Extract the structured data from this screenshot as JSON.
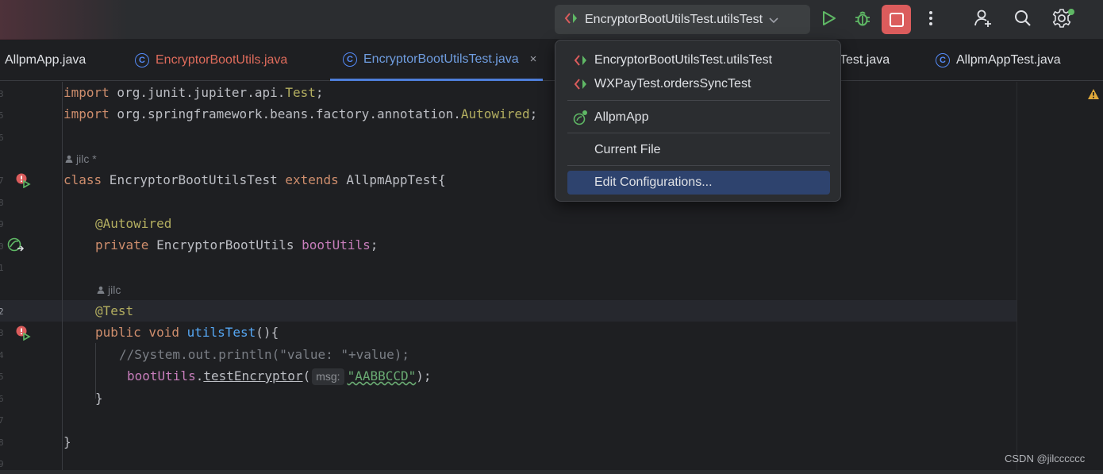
{
  "toolbar": {
    "run_config_label": "EncryptorBootUtilsTest.utilsTest"
  },
  "tabs": [
    {
      "label": "AllpmApp.java"
    },
    {
      "label": "EncryptorBootUtils.java"
    },
    {
      "label": "EncryptorBootUtilsTest.java"
    },
    {
      "label": "Test.java"
    },
    {
      "label": "AllpmAppTest.java"
    }
  ],
  "tab_close_glyph": "×",
  "menu": {
    "items": [
      {
        "label": "EncryptorBootUtilsTest.utilsTest"
      },
      {
        "label": "WXPayTest.ordersSyncTest"
      },
      {
        "label": "AllpmApp"
      },
      {
        "label": "Current File"
      },
      {
        "label": "Edit Configurations..."
      }
    ]
  },
  "editor": {
    "line_numbers": [
      "3",
      "5",
      "6",
      "7",
      "8",
      "9",
      "0",
      "1",
      "2",
      "3",
      "4",
      "5",
      "6",
      "7",
      "8",
      "9"
    ],
    "import1": {
      "kw": "import",
      "pkg": " org.junit.jupiter.api.",
      "cls": "Test",
      "end": ";"
    },
    "import2": {
      "kw": "import",
      "pkg": " org.springframework.beans.factory.annotation.",
      "cls": "Autowired",
      "end": ";"
    },
    "author1": "jilc *",
    "class_line": {
      "kw1": "class",
      "name": " EncryptorBootUtilsTest ",
      "kw2": "extends",
      "rest": " AllpmAppTest{"
    },
    "autowired": "@Autowired",
    "field_line": {
      "kw": "private",
      "type": " EncryptorBootUtils ",
      "field": "bootUtils",
      "end": ";"
    },
    "author2": "jilc",
    "test_ann": "@Test",
    "method_line": {
      "kw1": "public",
      "kw2": " void",
      "name": " utilsTest",
      "end": "(){"
    },
    "comment": "//System.out.println(\"value: \"+value);",
    "call_line": {
      "obj": "bootUtils",
      "dot": ".",
      "method": "testEncryptor",
      "open": "(",
      "hint": "msg:",
      "arg": "\"AABBCCD\"",
      "close": ");"
    },
    "close_method": "}",
    "close_class": "}"
  },
  "watermark": "CSDN @jilcccccc"
}
